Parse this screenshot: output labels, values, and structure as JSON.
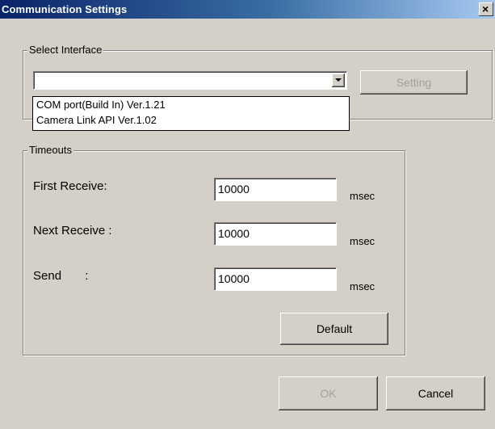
{
  "window": {
    "title": "Communication Settings",
    "close_glyph": "×"
  },
  "interface_group": {
    "legend": "Select Interface",
    "combo_value": "",
    "options": [
      "COM port(Build In) Ver.1.21",
      "Camera Link API Ver.1.02"
    ],
    "setting_label": "Setting"
  },
  "timeouts_group": {
    "legend": "Timeouts",
    "rows": [
      {
        "label": "First Receive:",
        "value": "10000",
        "unit": "msec"
      },
      {
        "label": "Next Receive :",
        "value": "10000",
        "unit": "msec"
      },
      {
        "label": "Send       :",
        "value": "10000",
        "unit": "msec"
      }
    ],
    "default_label": "Default"
  },
  "footer": {
    "ok_label": "OK",
    "cancel_label": "Cancel"
  }
}
